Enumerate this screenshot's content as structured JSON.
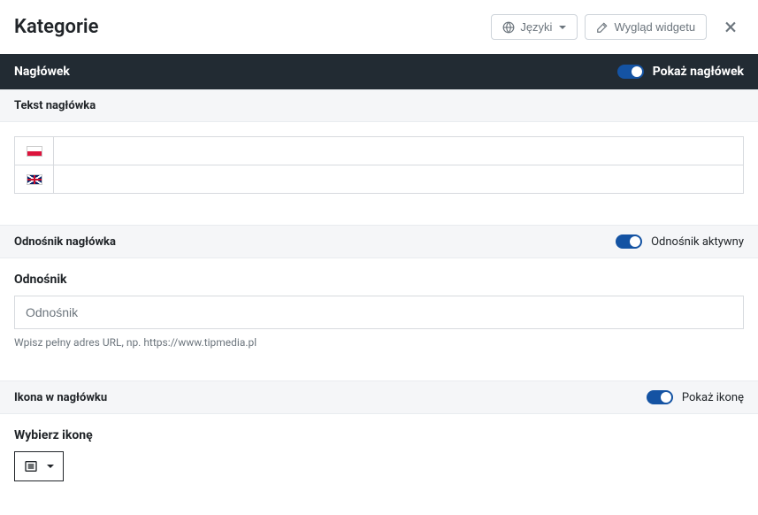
{
  "header": {
    "title": "Kategorie",
    "languages_button": "Języki",
    "widget_look_button": "Wygląd widgetu"
  },
  "section_header": {
    "title": "Nagłówek",
    "toggle_label": "Pokaż nagłówek",
    "toggle_on": true
  },
  "header_text": {
    "label": "Tekst nagłówka"
  },
  "header_link": {
    "section_title": "Odnośnik nagłówka",
    "toggle_label": "Odnośnik aktywny",
    "toggle_on": true,
    "field_label": "Odnośnik",
    "placeholder": "Odnośnik",
    "help": "Wpisz pełny adres URL, np. https://www.tipmedia.pl"
  },
  "header_icon": {
    "section_title": "Ikona w nagłówku",
    "toggle_label": "Pokaż ikonę",
    "toggle_on": true,
    "field_label": "Wybierz ikonę"
  }
}
